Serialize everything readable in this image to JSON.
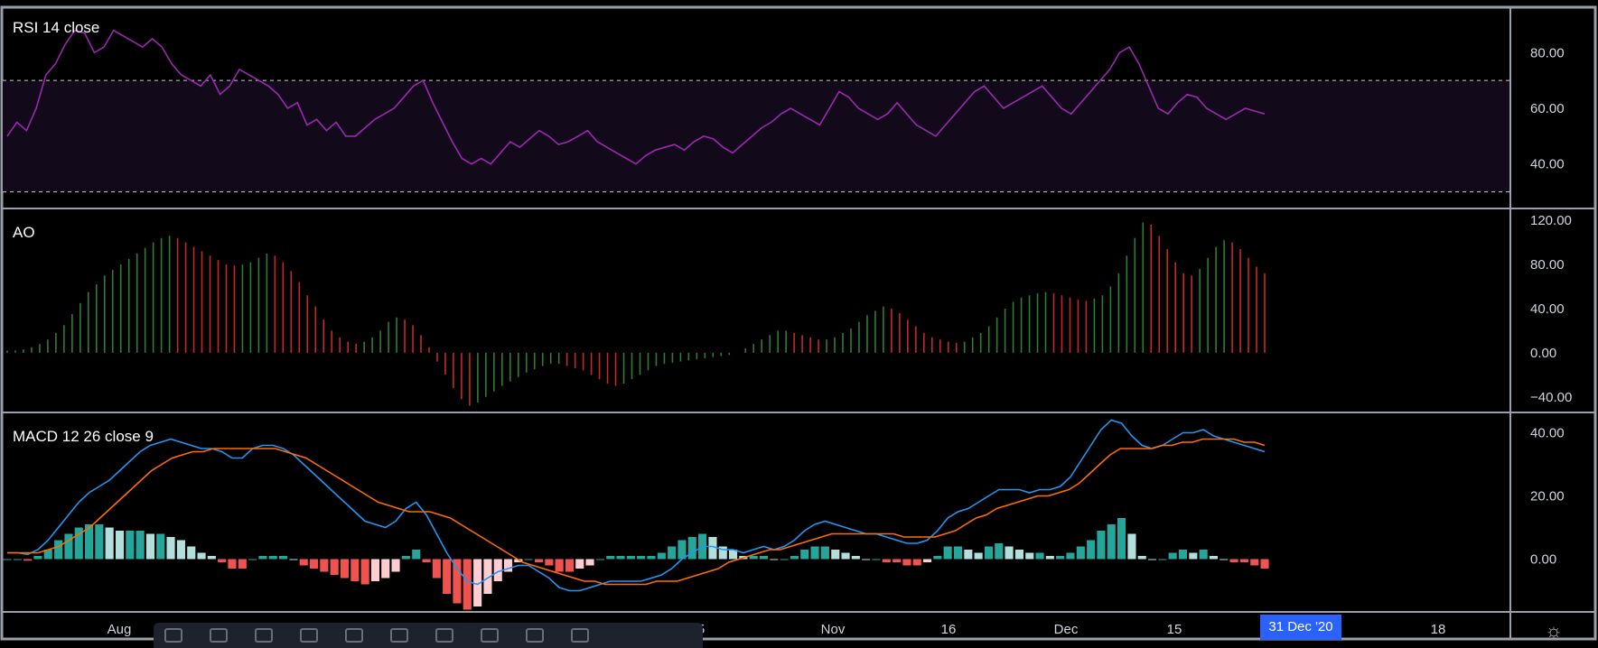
{
  "panes": {
    "rsi": {
      "label": "RSI 14 close",
      "upper_band": 70,
      "lower_band": 30,
      "ticks": [
        "80.00",
        "60.00",
        "40.00"
      ],
      "colors": {
        "line": "#9c27b0",
        "band_fill": "#120a1a",
        "band_line": "#cccccc"
      }
    },
    "ao": {
      "label": "AO",
      "ticks": [
        "120.00",
        "80.00",
        "40.00",
        "0.00",
        "−40.00"
      ],
      "colors": {
        "up": "#26a69a",
        "down": "#ef5350",
        "green": "#2e7d32",
        "red": "#c62828"
      }
    },
    "macd": {
      "label": "MACD 12 26 close 9",
      "ticks": [
        "40.00",
        "20.00",
        "0.00"
      ],
      "colors": {
        "macd": "#2196f3",
        "signal": "#ff6d00",
        "hist_up_strong": "#26a69a",
        "hist_up_weak": "#b2dfdb",
        "hist_down_strong": "#ef5350",
        "hist_down_weak": "#ffcdd2"
      }
    }
  },
  "time_axis": {
    "labels": [
      "Aug",
      "Nov",
      "16",
      "Dec",
      "15",
      "18"
    ],
    "partial_label": "5",
    "crosshair_date": "31 Dec '20"
  },
  "chart_data": [
    {
      "type": "line",
      "title": "RSI 14 close",
      "ylim": [
        25,
        95
      ],
      "series": [
        {
          "values": [
            50,
            55,
            52,
            60,
            72,
            76,
            83,
            88,
            87,
            80,
            82,
            88,
            86,
            84,
            82,
            85,
            82,
            76,
            72,
            70,
            68,
            72,
            65,
            68,
            74,
            72,
            70,
            68,
            65,
            60,
            62,
            54,
            56,
            52,
            55,
            50,
            50,
            53,
            56,
            58,
            60,
            64,
            68,
            70,
            62,
            55,
            48,
            42,
            40,
            42,
            40,
            44,
            48,
            46,
            49,
            52,
            50,
            47,
            48,
            50,
            52,
            48,
            46,
            44,
            42,
            40,
            43,
            45,
            46,
            47,
            45,
            48,
            50,
            49,
            46,
            44,
            47,
            50,
            53,
            55,
            58,
            60,
            58,
            56,
            54,
            60,
            66,
            64,
            60,
            58,
            56,
            58,
            62,
            58,
            54,
            52,
            50,
            54,
            58,
            62,
            66,
            68,
            64,
            60,
            62,
            64,
            66,
            68,
            64,
            60,
            58,
            62,
            66,
            70,
            74,
            80,
            82,
            76,
            68,
            60,
            58,
            62,
            65,
            64,
            60,
            58,
            56,
            58,
            60,
            59,
            58
          ]
        }
      ],
      "ylabel": ""
    },
    {
      "type": "bar",
      "title": "AO",
      "ylim": [
        -50,
        125
      ],
      "values": [
        2,
        2,
        3,
        5,
        8,
        12,
        18,
        25,
        35,
        45,
        55,
        62,
        70,
        75,
        80,
        85,
        90,
        95,
        100,
        104,
        106,
        104,
        100,
        96,
        92,
        88,
        84,
        80,
        79,
        80,
        82,
        86,
        90,
        88,
        82,
        74,
        64,
        52,
        42,
        30,
        20,
        14,
        10,
        8,
        10,
        14,
        20,
        28,
        32,
        30,
        25,
        16,
        5,
        -8,
        -20,
        -32,
        -42,
        -48,
        -45,
        -40,
        -35,
        -30,
        -26,
        -22,
        -18,
        -15,
        -12,
        -10,
        -10,
        -12,
        -14,
        -16,
        -20,
        -24,
        -28,
        -30,
        -28,
        -24,
        -20,
        -16,
        -12,
        -10,
        -9,
        -8,
        -7,
        -6,
        -5,
        -4,
        -3,
        -2,
        0,
        4,
        8,
        12,
        16,
        20,
        20,
        18,
        16,
        14,
        12,
        12,
        14,
        18,
        22,
        28,
        34,
        38,
        42,
        40,
        36,
        30,
        24,
        18,
        14,
        12,
        10,
        9,
        10,
        14,
        18,
        24,
        32,
        40,
        46,
        50,
        52,
        54,
        55,
        54,
        52,
        50,
        48,
        47,
        49,
        52,
        60,
        72,
        88,
        104,
        118,
        116,
        106,
        94,
        82,
        72,
        70,
        76,
        86,
        96,
        102,
        100,
        94,
        86,
        78,
        72
      ]
    },
    {
      "type": "line",
      "title": "MACD 12 26 close 9",
      "ylim": [
        -15,
        45
      ],
      "series": [
        {
          "values": [
            2,
            2,
            1.5,
            3,
            6,
            10,
            14,
            18,
            21,
            23,
            25,
            28,
            31,
            34,
            36,
            37,
            38,
            37,
            36,
            35,
            35,
            34,
            32,
            32,
            35,
            36,
            36,
            35,
            33,
            30,
            27,
            24,
            21,
            18,
            15,
            12,
            11,
            10,
            12,
            16,
            18,
            14,
            8,
            2,
            -3,
            -7,
            -8,
            -6,
            -4,
            -3,
            -2,
            -2,
            -4,
            -6,
            -9,
            -10,
            -10,
            -9,
            -8,
            -7,
            -7,
            -7,
            -7,
            -6,
            -5,
            -3,
            0,
            2,
            4,
            4,
            3,
            3,
            2,
            3,
            4,
            3,
            4,
            6,
            9,
            11,
            12,
            11,
            10,
            9,
            8,
            8,
            7,
            6,
            5,
            5,
            6,
            9,
            13,
            15,
            16,
            18,
            20,
            22,
            22,
            22,
            21,
            22,
            22,
            23,
            26,
            31,
            36,
            41,
            44,
            43,
            39,
            36,
            35,
            36,
            38,
            40,
            40,
            41,
            39,
            38,
            37,
            36,
            35,
            34
          ]
        },
        {
          "values": [
            2,
            2,
            2,
            2,
            3,
            4,
            6,
            8,
            10,
            13,
            16,
            19,
            22,
            25,
            28,
            30,
            32,
            33,
            34,
            34,
            35,
            35,
            35,
            35,
            35,
            35,
            35,
            34,
            33,
            32,
            30,
            28,
            26,
            24,
            22,
            20,
            18,
            17,
            16,
            15,
            15,
            15,
            14,
            13,
            11,
            9,
            7,
            5,
            3,
            1,
            -1,
            -2,
            -3,
            -4,
            -5,
            -6,
            -7,
            -7,
            -8,
            -8,
            -8,
            -8,
            -8,
            -7,
            -7,
            -7,
            -6,
            -5,
            -4,
            -3,
            -1,
            0,
            1,
            2,
            3,
            3,
            4,
            5,
            6,
            7,
            8,
            8,
            8,
            8,
            8,
            8,
            8,
            7,
            7,
            7,
            7,
            8,
            9,
            11,
            13,
            14,
            16,
            17,
            18,
            19,
            20,
            20,
            21,
            22,
            24,
            27,
            30,
            33,
            35,
            35,
            35,
            35,
            36,
            36,
            37,
            37,
            38,
            38,
            38,
            38,
            37,
            37,
            36
          ]
        }
      ],
      "histogram": [
        0,
        0,
        -0.5,
        1,
        3,
        6,
        8,
        10,
        11,
        11,
        10,
        9,
        9,
        9,
        8,
        8,
        7,
        6,
        4,
        2,
        1,
        -1,
        -3,
        -3,
        0,
        1,
        1,
        1,
        0,
        -2,
        -3,
        -4,
        -5,
        -6,
        -7,
        -8,
        -7,
        -6,
        -4,
        1,
        3,
        -1,
        -6,
        -11,
        -14,
        -16,
        -15,
        -11,
        -7,
        -4,
        -1,
        0,
        -1,
        -2,
        -4,
        -4,
        -3,
        -2,
        0,
        1,
        1,
        1,
        1,
        1,
        2,
        4,
        6,
        7,
        8,
        7,
        4,
        3,
        1,
        1,
        1,
        0,
        0,
        1,
        3,
        4,
        4,
        3,
        2,
        1,
        0,
        0,
        -1,
        -1,
        -2,
        -2,
        -1,
        1,
        4,
        4,
        3,
        2,
        4,
        5,
        4,
        3,
        2,
        2,
        1,
        1,
        2,
        4,
        6,
        9,
        11,
        13,
        8,
        1,
        0,
        0,
        2,
        3,
        2,
        3,
        1,
        0,
        -1,
        -1,
        -2,
        -3
      ]
    }
  ]
}
